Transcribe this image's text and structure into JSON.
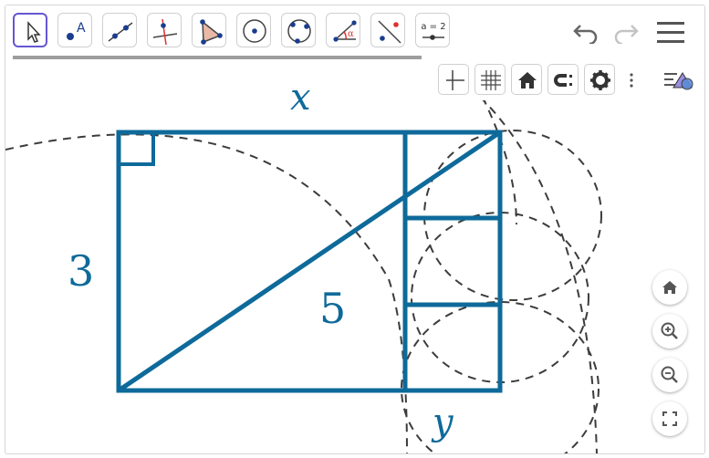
{
  "toolbar": {
    "tools": [
      {
        "name": "move-tool",
        "icon": "arrow-cursor-icon",
        "selected": true
      },
      {
        "name": "point-tool",
        "icon": "point-icon",
        "letter": "A"
      },
      {
        "name": "line-tool",
        "icon": "line-icon"
      },
      {
        "name": "perpendicular-line-tool",
        "icon": "perpendicular-icon"
      },
      {
        "name": "polygon-tool",
        "icon": "polygon-icon"
      },
      {
        "name": "circle-center-point-tool",
        "icon": "circle-icon"
      },
      {
        "name": "circle-three-points-tool",
        "icon": "circle-3pt-icon"
      },
      {
        "name": "angle-tool",
        "icon": "angle-icon",
        "letter": "α"
      },
      {
        "name": "reflect-tool",
        "icon": "reflect-icon"
      },
      {
        "name": "slider-tool",
        "icon": "slider-icon",
        "label": "a = 2"
      }
    ],
    "undo_icon": "undo-icon",
    "redo_icon": "redo-icon",
    "menu_icon": "hamburger-menu-icon"
  },
  "stylebar": {
    "buttons": [
      "axes-icon",
      "grid-icon",
      "home-icon",
      "magnet-snap-icon",
      "gear-icon",
      "more-vertical-icon"
    ],
    "toggle_icon": "stylebar-toggle-icon"
  },
  "zoom_buttons": [
    "home-icon",
    "zoom-in-icon",
    "zoom-out-icon",
    "fullscreen-icon"
  ],
  "graphics": {
    "label_x": "x",
    "label_y": "y",
    "label_3": "3",
    "label_5": "5"
  },
  "colors": {
    "accent": "#6557d2",
    "figure_blue": "#0e6a9a",
    "dashed": "#3c3c3c",
    "toolbar_icon": "#555555"
  }
}
